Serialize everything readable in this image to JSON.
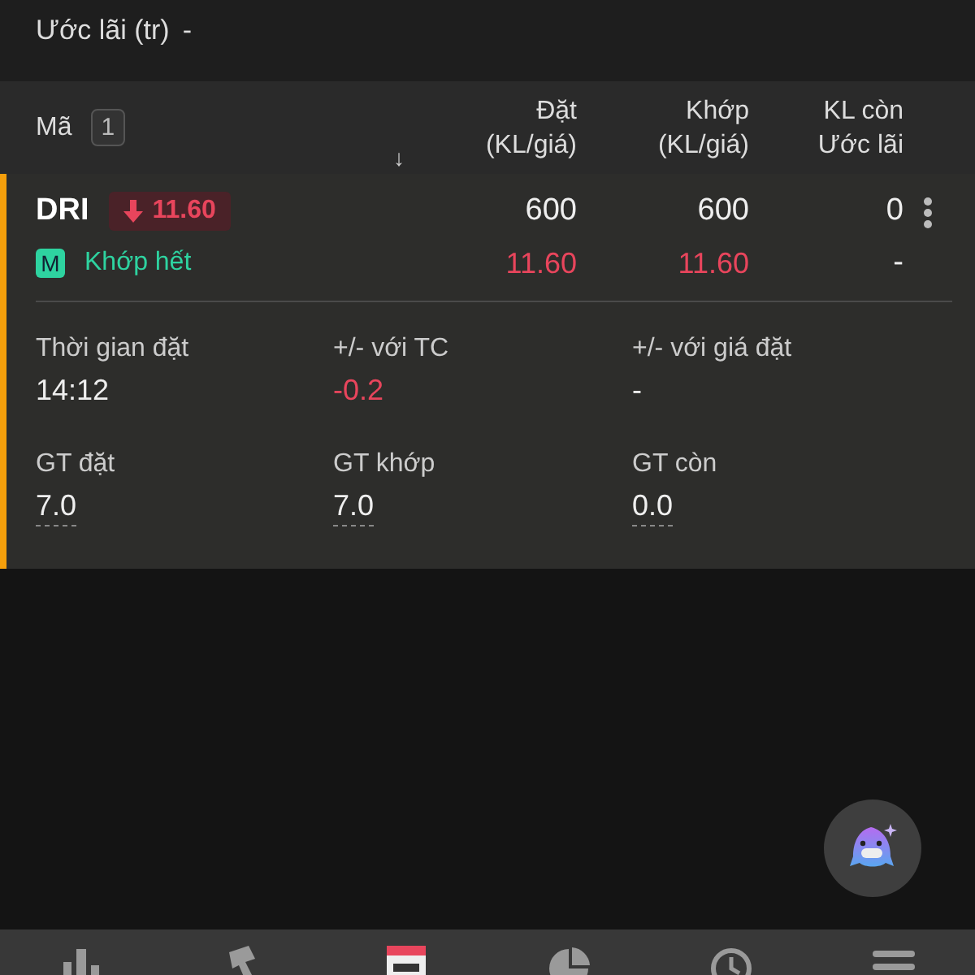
{
  "summary": {
    "label": "Ước lãi (tr)",
    "value": "-"
  },
  "header": {
    "code_label": "Mã",
    "count": "1",
    "sort_arrow": "↓",
    "columns": [
      {
        "line1": "Đặt",
        "line2": "(KL/giá)"
      },
      {
        "line1": "Khớp",
        "line2": "(KL/giá)"
      },
      {
        "line1": "KL còn",
        "line2": "Ước lãi"
      }
    ]
  },
  "orders": [
    {
      "symbol": "DRI",
      "price_down": true,
      "price_badge": "11.60",
      "type_badge": "M",
      "status": "Khớp hết",
      "order_qty": "600",
      "order_price": "11.60",
      "match_qty": "600",
      "match_price": "11.60",
      "remaining": "0",
      "est_profit": "-",
      "details": [
        {
          "label": "Thời gian đặt",
          "value": "14:12",
          "negative": false,
          "underlined": false
        },
        {
          "label": "+/- với TC",
          "value": "-0.2",
          "negative": true,
          "underlined": false
        },
        {
          "label": "+/- với giá đặt",
          "value": "-",
          "negative": false,
          "underlined": false
        },
        {
          "label": "GT đặt",
          "value": "7.0",
          "negative": false,
          "underlined": true
        },
        {
          "label": "GT khớp",
          "value": "7.0",
          "negative": false,
          "underlined": true
        },
        {
          "label": "GT còn",
          "value": "0.0",
          "negative": false,
          "underlined": true
        }
      ]
    }
  ],
  "nav": [
    {
      "kind": "chart",
      "selected": false
    },
    {
      "kind": "gavel",
      "selected": false
    },
    {
      "kind": "orders",
      "selected": true
    },
    {
      "kind": "pie",
      "selected": false
    },
    {
      "kind": "clock",
      "selected": false
    },
    {
      "kind": "menu",
      "selected": false
    }
  ]
}
